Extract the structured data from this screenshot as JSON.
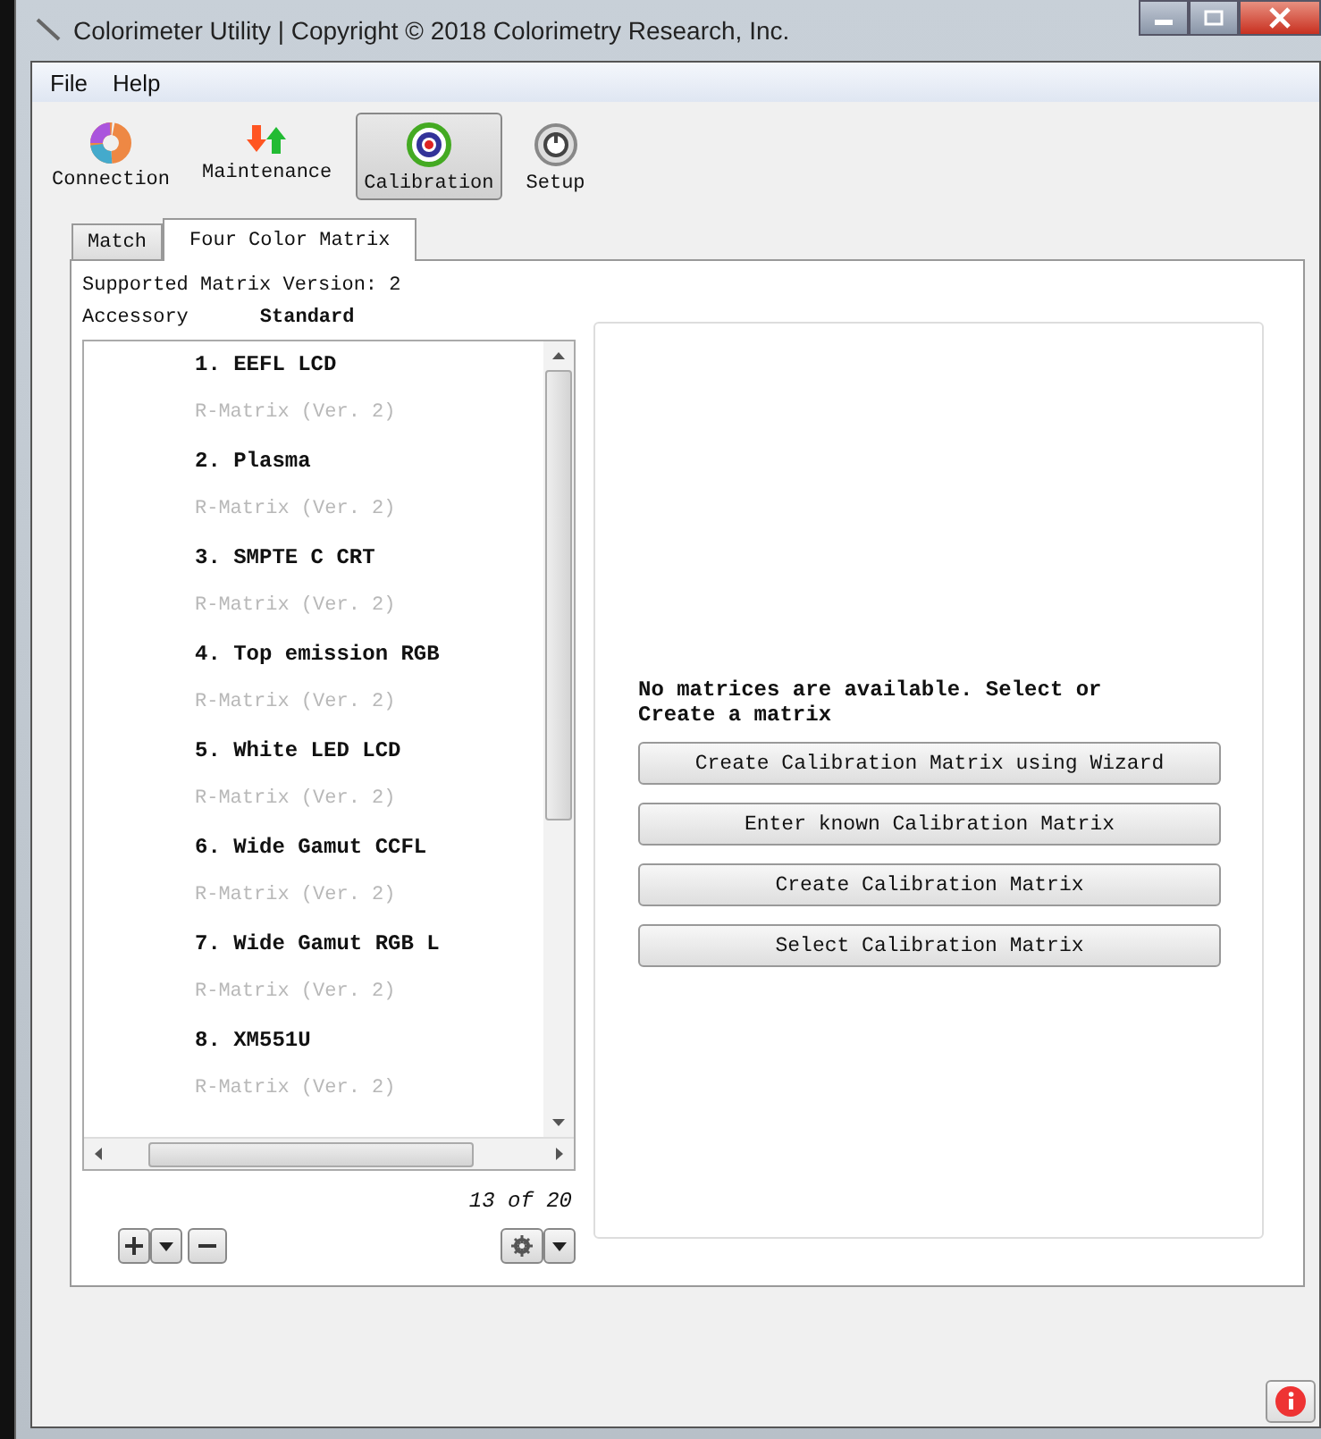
{
  "window": {
    "title": "Colorimeter Utility | Copyright © 2018 Colorimetry Research, Inc."
  },
  "menu": [
    "File",
    "Help"
  ],
  "toolbar": [
    {
      "label": "Connection",
      "kind": "connection",
      "selected": false
    },
    {
      "label": "Maintenance",
      "kind": "maintenance",
      "selected": false
    },
    {
      "label": "Calibration",
      "kind": "calibration",
      "selected": true
    },
    {
      "label": "Setup",
      "kind": "setup",
      "selected": false
    }
  ],
  "tabs": [
    {
      "label": "Match",
      "selected": false
    },
    {
      "label": "Four Color Matrix",
      "selected": true
    }
  ],
  "supported_version": "Supported Matrix Version: 2",
  "accessory": {
    "label": "Accessory",
    "value": "Standard"
  },
  "matrix_list": [
    {
      "name": "1. EEFL LCD",
      "type": "R-Matrix (Ver. 2)"
    },
    {
      "name": "2. Plasma",
      "type": "R-Matrix (Ver. 2)"
    },
    {
      "name": "3. SMPTE C CRT",
      "type": "R-Matrix (Ver. 2)"
    },
    {
      "name": "4. Top emission RGB",
      "type": "R-Matrix (Ver. 2)"
    },
    {
      "name": "5. White LED LCD",
      "type": "R-Matrix (Ver. 2)"
    },
    {
      "name": "6. Wide Gamut CCFL",
      "type": "R-Matrix (Ver. 2)"
    },
    {
      "name": "7. Wide Gamut RGB L",
      "type": "R-Matrix (Ver. 2)"
    },
    {
      "name": "8. XM551U",
      "type": "R-Matrix (Ver. 2)"
    }
  ],
  "count": "13 of 20",
  "message": "No matrices are available. Select or Create a matrix",
  "actions": [
    "Create Calibration Matrix using Wizard",
    "Enter known Calibration Matrix",
    "Create Calibration Matrix",
    "Select Calibration Matrix"
  ]
}
